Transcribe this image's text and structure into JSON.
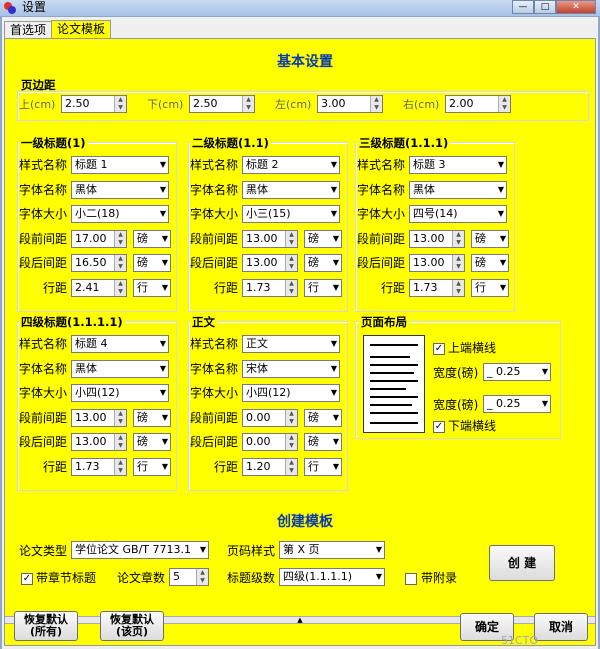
{
  "window": {
    "title": "设置",
    "controls": [
      "—",
      "□",
      "✕"
    ]
  },
  "tabs": [
    "首选项",
    "论文模板"
  ],
  "basic": {
    "title": "基本设置",
    "margin_group": "页边距",
    "margins": [
      {
        "label": "上(cm)",
        "value": "2.50"
      },
      {
        "label": "下(cm)",
        "value": "2.50"
      },
      {
        "label": "左(cm)",
        "value": "3.00"
      },
      {
        "label": "右(cm)",
        "value": "2.00"
      }
    ]
  },
  "labels": {
    "style_name": "样式名称",
    "font_name": "字体名称",
    "font_size": "字体大小",
    "space_before": "段前间距",
    "space_after": "段后间距",
    "line_spacing": "行距"
  },
  "headings": [
    {
      "title": "一级标题(1)",
      "style": "标题 1",
      "font": "黑体",
      "size": "小二(18)",
      "before": "17.00",
      "before_unit": "磅",
      "after": "16.50",
      "after_unit": "磅",
      "line": "2.41",
      "line_unit": "行"
    },
    {
      "title": "二级标题(1.1)",
      "style": "标题 2",
      "font": "黑体",
      "size": "小三(15)",
      "before": "13.00",
      "before_unit": "磅",
      "after": "13.00",
      "after_unit": "磅",
      "line": "1.73",
      "line_unit": "行"
    },
    {
      "title": "三级标题(1.1.1)",
      "style": "标题 3",
      "font": "黑体",
      "size": "四号(14)",
      "before": "13.00",
      "before_unit": "磅",
      "after": "13.00",
      "after_unit": "磅",
      "line": "1.73",
      "line_unit": "行"
    },
    {
      "title": "四级标题(1.1.1.1)",
      "style": "标题 4",
      "font": "黑体",
      "size": "小四(12)",
      "before": "13.00",
      "before_unit": "磅",
      "after": "13.00",
      "after_unit": "磅",
      "line": "1.73",
      "line_unit": "行"
    },
    {
      "title": "正文",
      "style": "正文",
      "font": "宋体",
      "size": "小四(12)",
      "before": "0.00",
      "before_unit": "磅",
      "after": "0.00",
      "after_unit": "磅",
      "line": "1.20",
      "line_unit": "行"
    }
  ],
  "layout": {
    "title": "页面布局",
    "top_line_label": "上端横线",
    "width_label": "宽度(磅)",
    "top_width": "_ 0.25",
    "bottom_width": "_ 0.25",
    "bottom_line_label": "下端横线"
  },
  "template": {
    "title": "创建模板",
    "type_label": "论文类型",
    "type_value": "学位论文 GB/T 7713.1",
    "page_num_label": "页码样式",
    "page_num_value": "第 X 页",
    "create_button": "创  建",
    "chapter_title_label": "带章节标题",
    "chapters_label": "论文章数",
    "chapters_value": "5",
    "heading_level_label": "标题级数",
    "heading_level_value": "四级(1.1.1.1)",
    "appendix_label": "带附录"
  },
  "footer": {
    "restore_all_1": "恢复默认",
    "restore_all_2": "(所有)",
    "restore_page_1": "恢复默认",
    "restore_page_2": "(该页)",
    "ok": "确定",
    "cancel": "取消"
  },
  "colors": {
    "panel": "#ffff00",
    "section_title": "#0c3caa"
  },
  "watermark": "51CTO"
}
